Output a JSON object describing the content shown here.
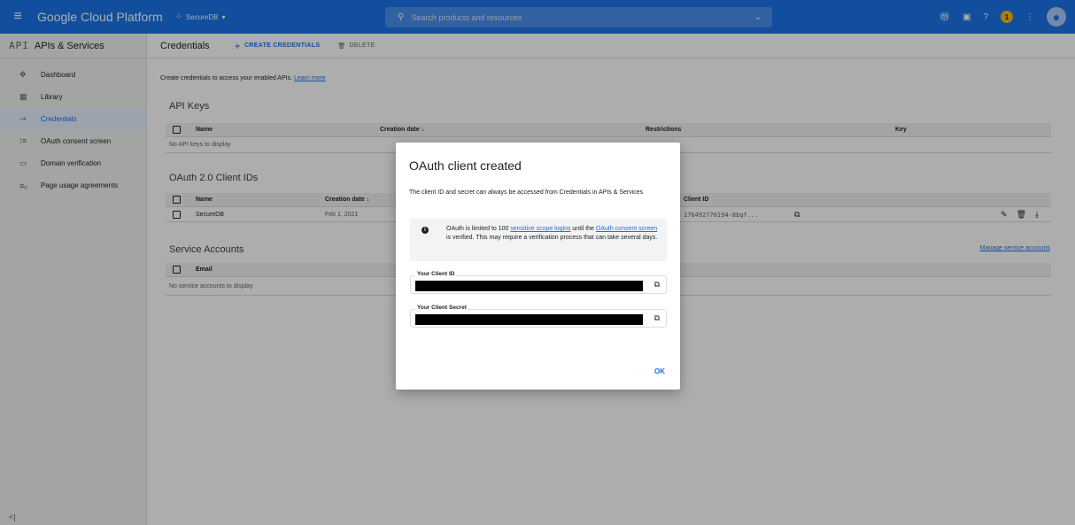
{
  "topbar": {
    "brand": "Google Cloud Platform",
    "project": "SecureDB",
    "search_placeholder": "Search products and resources",
    "notification_count": "1",
    "accent": "#1a73e8"
  },
  "sidebar": {
    "logo": "API",
    "title": "APIs & Services",
    "items": [
      {
        "label": "Dashboard",
        "icon": "dashboard-icon"
      },
      {
        "label": "Library",
        "icon": "library-icon"
      },
      {
        "label": "Credentials",
        "icon": "key-icon",
        "active": true
      },
      {
        "label": "OAuth consent screen",
        "icon": "consent-icon"
      },
      {
        "label": "Domain verification",
        "icon": "domain-icon"
      },
      {
        "label": "Page usage agreements",
        "icon": "agreements-icon"
      }
    ]
  },
  "main": {
    "title": "Credentials",
    "create_label": "CREATE CREDENTIALS",
    "delete_label": "DELETE",
    "intro_text": "Create credentials to access your enabled APIs.",
    "learn_more": "Learn more",
    "api_keys": {
      "title": "API Keys",
      "columns": [
        "Name",
        "Creation date",
        "Restrictions",
        "Key"
      ],
      "empty": "No API keys to display"
    },
    "oauth": {
      "title": "OAuth 2.0 Client IDs",
      "columns": [
        "Name",
        "Creation date",
        "Client ID"
      ],
      "rows": [
        {
          "name": "SecureDB",
          "date": "Feb 1, 2021",
          "client_id": "176492776194-8bqf..."
        }
      ]
    },
    "service_accounts": {
      "title": "Service Accounts",
      "manage_link": "Manage service accounts",
      "columns": [
        "Email"
      ],
      "empty": "No service accounts to display"
    }
  },
  "dialog": {
    "title": "OAuth client created",
    "description": "The client ID and secret can always be accessed from Credentials in APIs & Services",
    "info_prefix": "OAuth is limited to 100 ",
    "info_link1": "sensitive scope logins",
    "info_middle": " until the ",
    "info_link2": "OAuth consent screen",
    "info_suffix": " is verified. This may require a verification process that can take several days.",
    "client_id_label": "Your Client ID",
    "client_secret_label": "Your Client Secret",
    "ok_label": "OK"
  }
}
